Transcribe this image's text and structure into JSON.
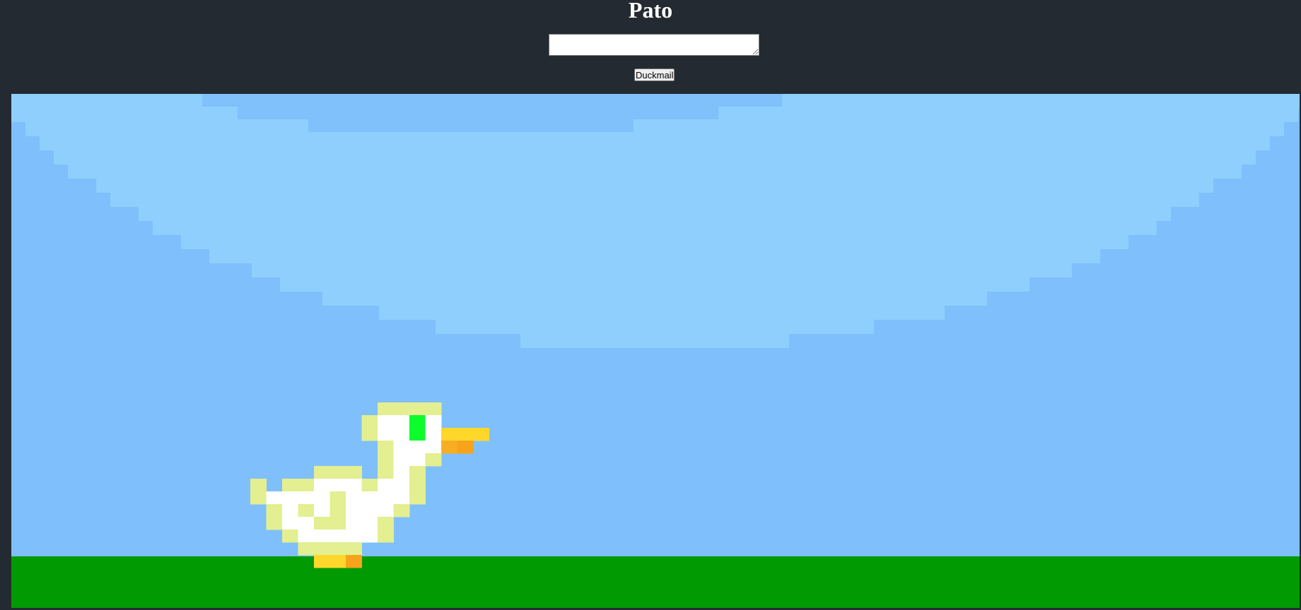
{
  "page": {
    "title": "Pato"
  },
  "message_input": {
    "value": "",
    "placeholder": ""
  },
  "duckmail_button": {
    "label": "Duckmail"
  },
  "game": {
    "sky_color": "#7fbffb",
    "sky_light_color": "#8ecffd",
    "ground_color": "#019a02",
    "duck_sprite": "white-duck-icon"
  }
}
